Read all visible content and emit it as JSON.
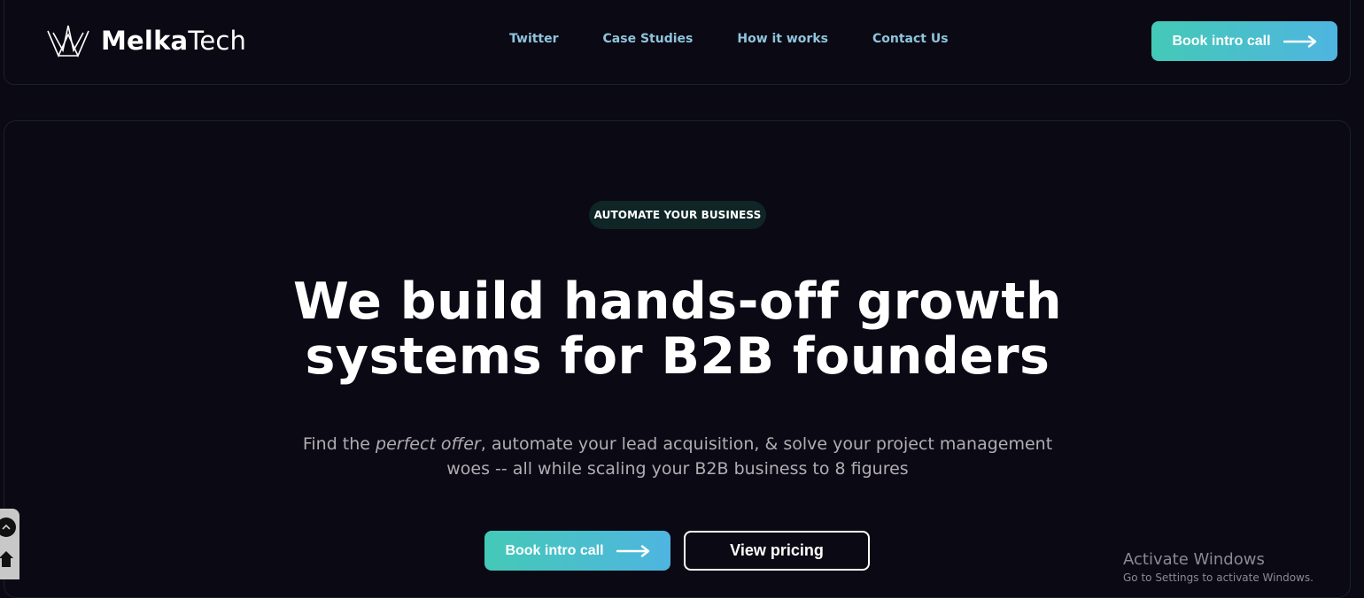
{
  "brand": {
    "name_bold": "Melka",
    "name_regular": "Tech"
  },
  "nav": {
    "links": [
      {
        "label": "Twitter"
      },
      {
        "label": "Case Studies"
      },
      {
        "label": "How it works"
      },
      {
        "label": "Contact Us"
      }
    ],
    "cta_label": "Book intro call"
  },
  "hero": {
    "eyebrow": "AUTOMATE YOUR BUSINESS",
    "headline_line1": "We build hands-off growth",
    "headline_line2": "systems for B2B founders",
    "sub_before": "Find the ",
    "sub_emphasis": "perfect offer",
    "sub_after": ", automate your lead acquisition, & solve your project management woes -- all while scaling your B2B business to 8 figures",
    "primary_cta": "Book intro call",
    "secondary_cta": "View pricing"
  },
  "os_overlay": {
    "title": "Activate Windows",
    "subtitle": "Go to Settings to activate Windows."
  },
  "colors": {
    "background": "#0b0914",
    "accent_gradient_start": "#44c9b7",
    "accent_gradient_end": "#4fb5e0",
    "nav_link": "#8fc4db",
    "pill_bg": "#0f2526"
  },
  "icons": [
    "crown-logo-icon",
    "arrow-right-icon",
    "chevron-up-icon",
    "home-icon"
  ]
}
